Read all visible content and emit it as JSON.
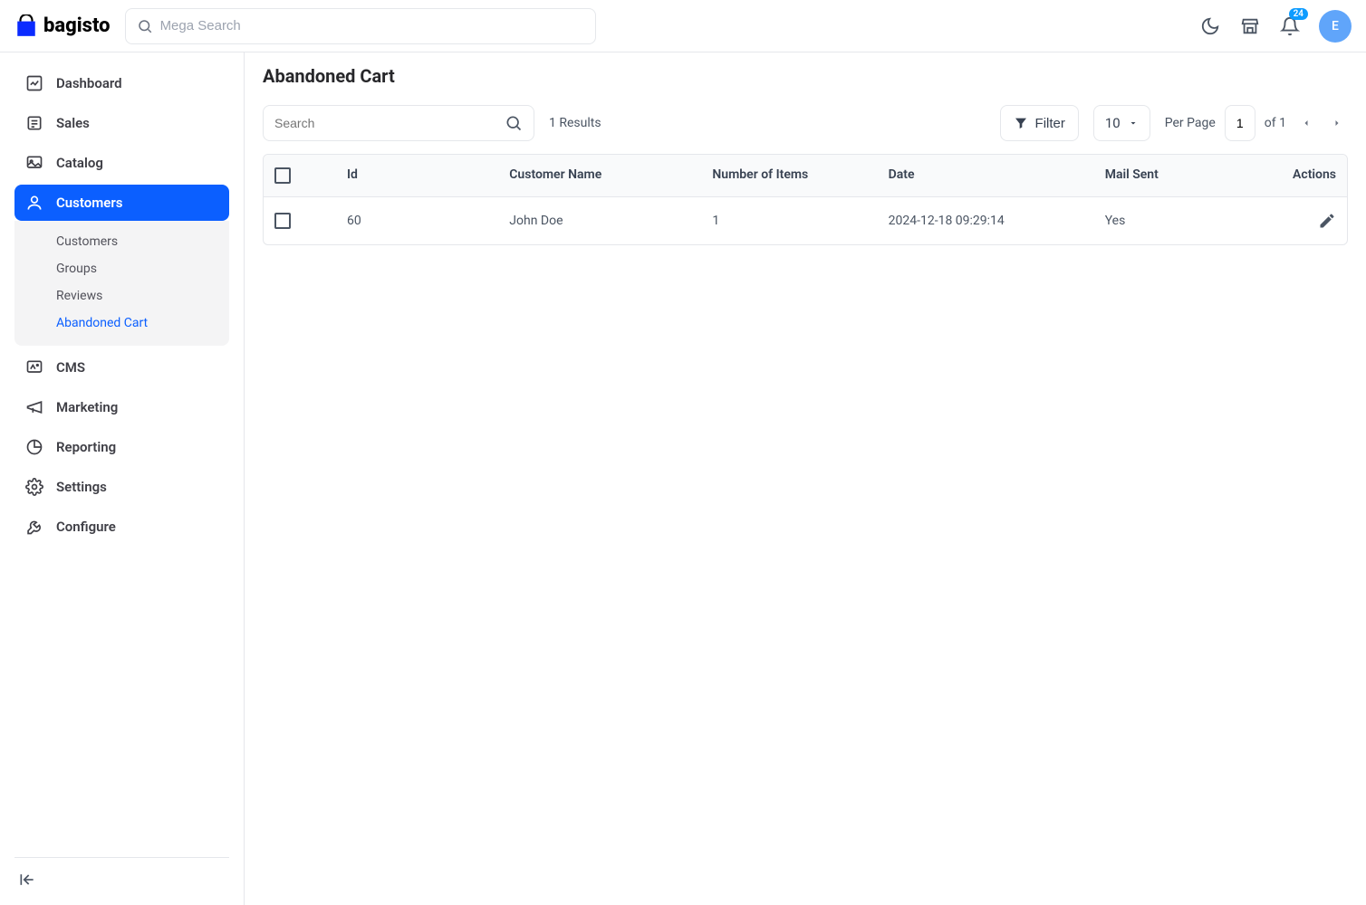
{
  "brand": "bagisto",
  "header": {
    "search_placeholder": "Mega Search",
    "notification_count": "24",
    "avatar_letter": "E"
  },
  "sidebar": {
    "items": [
      {
        "label": "Dashboard"
      },
      {
        "label": "Sales"
      },
      {
        "label": "Catalog"
      },
      {
        "label": "Customers"
      },
      {
        "label": "CMS"
      },
      {
        "label": "Marketing"
      },
      {
        "label": "Reporting"
      },
      {
        "label": "Settings"
      },
      {
        "label": "Configure"
      }
    ],
    "customers_sub": [
      {
        "label": "Customers"
      },
      {
        "label": "Groups"
      },
      {
        "label": "Reviews"
      },
      {
        "label": "Abandoned Cart"
      }
    ]
  },
  "page": {
    "title": "Abandoned Cart",
    "search_placeholder": "Search",
    "results_text": "1 Results",
    "filter_label": "Filter",
    "per_page_value": "10",
    "per_page_label": "Per Page",
    "page_value": "1",
    "of_text": "of 1"
  },
  "table": {
    "columns": {
      "id": "Id",
      "customer": "Customer Name",
      "items": "Number of Items",
      "date": "Date",
      "mail": "Mail Sent",
      "actions": "Actions"
    },
    "rows": [
      {
        "id": "60",
        "customer": "John Doe",
        "items": "1",
        "date": "2024-12-18 09:29:14",
        "mail": "Yes"
      }
    ]
  }
}
